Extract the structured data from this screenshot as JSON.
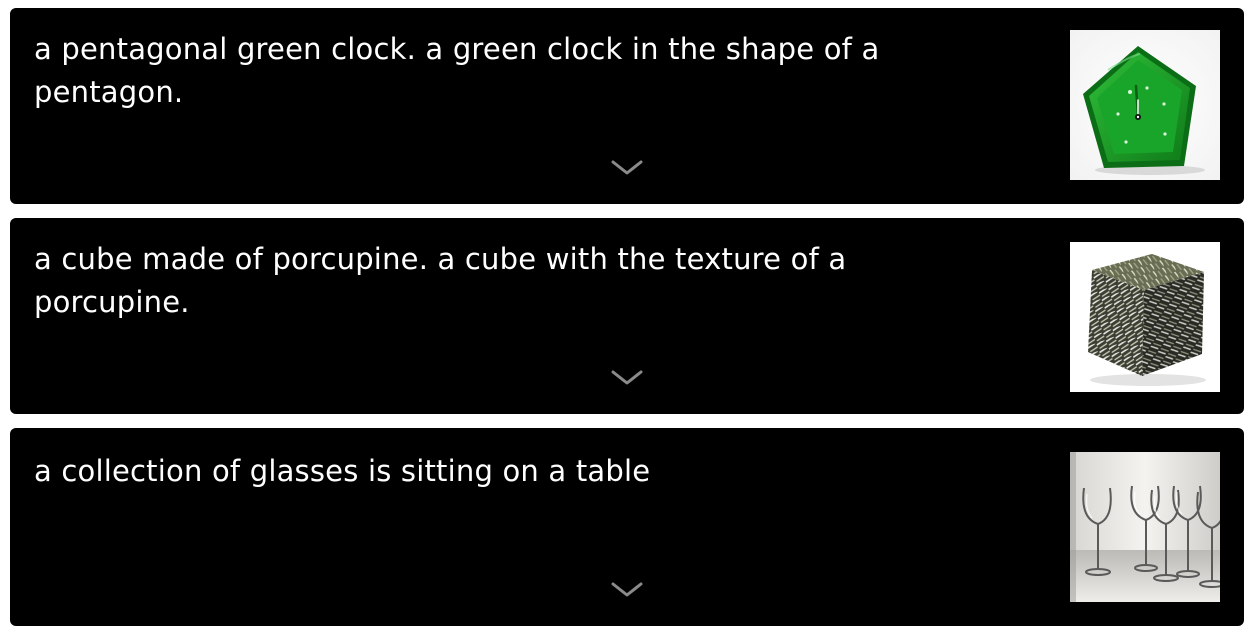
{
  "cards": [
    {
      "caption": "a pentagonal green clock. a green clock in the shape of a pentagon.",
      "expand_icon": "chevron-down-icon",
      "thumbnail": "green pentagon clock image"
    },
    {
      "caption": "a cube made of porcupine. a cube with the texture of a porcupine.",
      "expand_icon": "chevron-down-icon",
      "thumbnail": "porcupine-textured cube image"
    },
    {
      "caption": "a collection of glasses is sitting on a table",
      "expand_icon": "chevron-down-icon",
      "thumbnail": "wine glasses on table image"
    }
  ],
  "colors": {
    "card_background": "#000000",
    "caption_text": "#ffffff",
    "chevron": "#8a8a8a",
    "page_background": "#ffffff"
  }
}
